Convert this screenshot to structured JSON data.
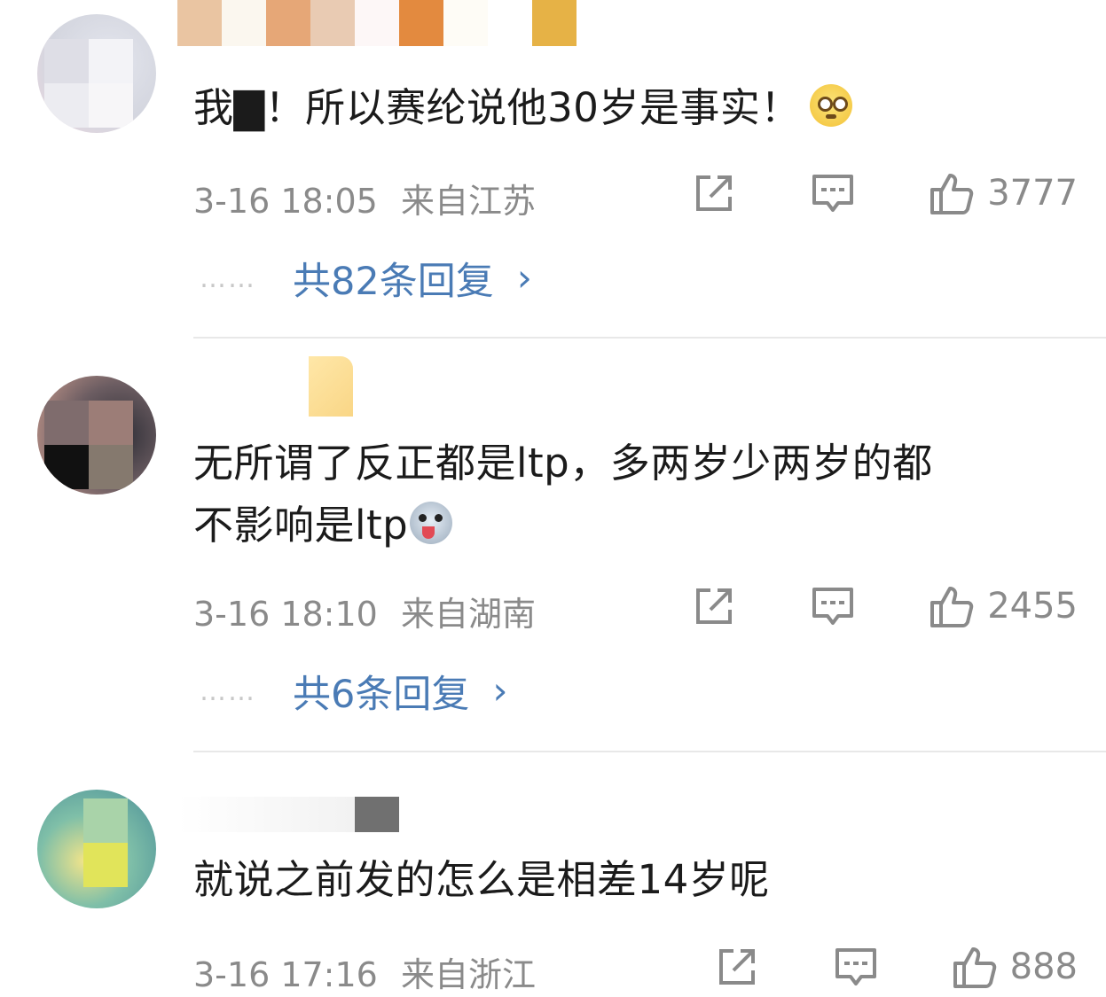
{
  "comments": [
    {
      "text": "我▇！所以赛纶说他30岁是事实！",
      "emoji": "face-emoji",
      "time": "3-16 18:05",
      "location": "来自江苏",
      "likes": "3777",
      "replies": "共82条回复"
    },
    {
      "text_line1": "无所谓了反正都是ltp，多两岁少两岁的都",
      "text_line2": "不影响是ltp",
      "emoji": "dog-emoji",
      "time": "3-16 18:10",
      "location": "来自湖南",
      "likes": "2455",
      "replies": "共6条回复"
    },
    {
      "text": "就说之前发的怎么是相差14岁呢",
      "time": "3-16 17:16",
      "location": "来自浙江",
      "likes": "888"
    }
  ],
  "icons": {
    "share": "share-icon",
    "comment": "comment-icon",
    "like": "thumbs-up-icon",
    "more_replies": "chevron-right-icon"
  },
  "colors": {
    "link": "#4a7bb5",
    "meta": "#8a8a8a",
    "divider": "#e8e8e8"
  }
}
